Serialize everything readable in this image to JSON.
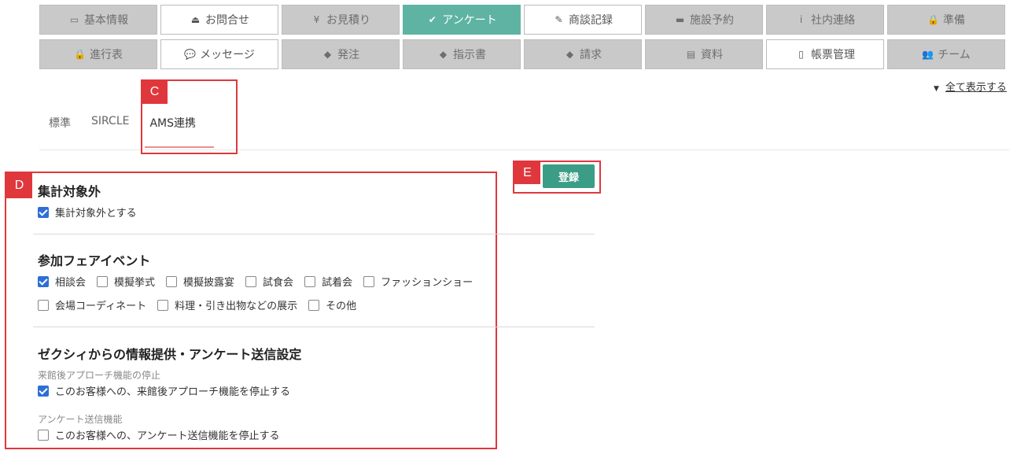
{
  "tabs": {
    "row1": [
      {
        "icon": "id-card-icon",
        "glyph": "▭",
        "label": "基本情報",
        "state": "normal"
      },
      {
        "icon": "eject-icon",
        "glyph": "⏏",
        "label": "お問合せ",
        "state": "white"
      },
      {
        "icon": "yen-icon",
        "glyph": "¥",
        "label": "お見積り",
        "state": "normal"
      },
      {
        "icon": "clipboard-check-icon",
        "glyph": "✔",
        "label": "アンケート",
        "state": "active"
      },
      {
        "icon": "user-edit-icon",
        "glyph": "✎",
        "label": "商談記録",
        "state": "white"
      },
      {
        "icon": "calendar-icon",
        "glyph": "▬",
        "label": "施設予約",
        "state": "normal"
      },
      {
        "icon": "info-icon",
        "glyph": "i",
        "label": "社内連絡",
        "state": "normal"
      },
      {
        "icon": "lock-icon",
        "glyph": "🔒",
        "label": "準備",
        "state": "normal"
      }
    ],
    "row2": [
      {
        "icon": "lock-icon",
        "glyph": "🔒",
        "label": "進行表",
        "state": "normal"
      },
      {
        "icon": "comments-icon",
        "glyph": "💬",
        "label": "メッセージ",
        "state": "white"
      },
      {
        "icon": "tag-icon",
        "glyph": "◆",
        "label": "発注",
        "state": "normal"
      },
      {
        "icon": "tag-icon",
        "glyph": "◆",
        "label": "指示書",
        "state": "normal"
      },
      {
        "icon": "tag-icon",
        "glyph": "◆",
        "label": "請求",
        "state": "normal"
      },
      {
        "icon": "archive-icon",
        "glyph": "▤",
        "label": "資料",
        "state": "normal"
      },
      {
        "icon": "file-icon",
        "glyph": "▯",
        "label": "帳票管理",
        "state": "white"
      },
      {
        "icon": "users-icon",
        "glyph": "👥",
        "label": "チーム",
        "state": "normal"
      }
    ]
  },
  "show_all": "全て表示する",
  "subtabs": [
    "標準",
    "SIRCLE",
    "AMS連携"
  ],
  "annotations": {
    "c": "C",
    "d": "D",
    "e": "E"
  },
  "submit_label": "登録",
  "section1": {
    "title": "集計対象外",
    "options": [
      {
        "label": "集計対象外とする",
        "checked": true
      }
    ]
  },
  "section2": {
    "title": "参加フェアイベント",
    "row1": [
      {
        "label": "相談会",
        "checked": true
      },
      {
        "label": "模擬挙式",
        "checked": false
      },
      {
        "label": "模擬披露宴",
        "checked": false
      },
      {
        "label": "試食会",
        "checked": false
      },
      {
        "label": "試着会",
        "checked": false
      },
      {
        "label": "ファッションショー",
        "checked": false
      }
    ],
    "row2": [
      {
        "label": "会場コーディネート",
        "checked": false
      },
      {
        "label": "料理・引き出物などの展示",
        "checked": false
      },
      {
        "label": "その他",
        "checked": false
      }
    ]
  },
  "section3": {
    "title": "ゼクシィからの情報提供・アンケート送信設定",
    "group1_label": "来館後アプローチ機能の停止",
    "group1_option": {
      "label": "このお客様への、来館後アプローチ機能を停止する",
      "checked": true
    },
    "group2_label": "アンケート送信機能",
    "group2_option": {
      "label": "このお客様への、アンケート送信機能を停止する",
      "checked": false
    }
  }
}
